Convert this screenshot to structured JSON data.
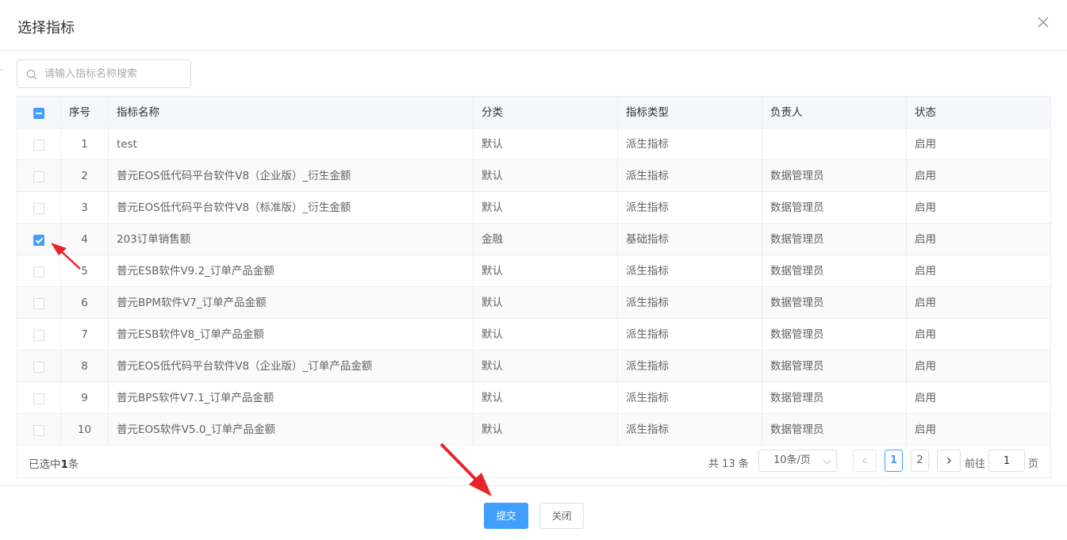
{
  "dialog": {
    "title": "选择指标"
  },
  "search": {
    "placeholder": "请输入指标名称搜索",
    "value": ""
  },
  "table": {
    "columns": [
      "序号",
      "指标名称",
      "分类",
      "指标类型",
      "负责人",
      "状态"
    ],
    "rows": [
      {
        "index": "1",
        "name": "test",
        "category": "默认",
        "type": "派生指标",
        "owner": "",
        "status": "启用",
        "checked": false
      },
      {
        "index": "2",
        "name": "普元EOS低代码平台软件V8（企业版）_衍生金额",
        "category": "默认",
        "type": "派生指标",
        "owner": "数据管理员",
        "status": "启用",
        "checked": false
      },
      {
        "index": "3",
        "name": "普元EOS低代码平台软件V8（标准版）_衍生金额",
        "category": "默认",
        "type": "派生指标",
        "owner": "数据管理员",
        "status": "启用",
        "checked": false
      },
      {
        "index": "4",
        "name": "203订单销售额",
        "category": "金融",
        "type": "基础指标",
        "owner": "数据管理员",
        "status": "启用",
        "checked": true
      },
      {
        "index": "5",
        "name": "普元ESB软件V9.2_订单产品金额",
        "category": "默认",
        "type": "派生指标",
        "owner": "数据管理员",
        "status": "启用",
        "checked": false
      },
      {
        "index": "6",
        "name": "普元BPM软件V7_订单产品金额",
        "category": "默认",
        "type": "派生指标",
        "owner": "数据管理员",
        "status": "启用",
        "checked": false
      },
      {
        "index": "7",
        "name": "普元ESB软件V8_订单产品金额",
        "category": "默认",
        "type": "派生指标",
        "owner": "数据管理员",
        "status": "启用",
        "checked": false
      },
      {
        "index": "8",
        "name": "普元EOS低代码平台软件V8（企业版）_订单产品金额",
        "category": "默认",
        "type": "派生指标",
        "owner": "数据管理员",
        "status": "启用",
        "checked": false
      },
      {
        "index": "9",
        "name": "普元BPS软件V7.1_订单产品金额",
        "category": "默认",
        "type": "派生指标",
        "owner": "数据管理员",
        "status": "启用",
        "checked": false
      },
      {
        "index": "10",
        "name": "普元EOS软件V5.0_订单产品金额",
        "category": "默认",
        "type": "派生指标",
        "owner": "数据管理员",
        "status": "启用",
        "checked": false
      }
    ]
  },
  "selection": {
    "prefix": "已选中",
    "count": "1",
    "suffix": "条"
  },
  "pagination": {
    "total_text": "共 13 条",
    "page_size": "10条/页",
    "pages": [
      "1",
      "2"
    ],
    "current_page": "1",
    "goto_label": "前往",
    "goto_value": "1",
    "goto_suffix": "页"
  },
  "footer": {
    "submit_label": "提交",
    "close_label": "关闭"
  },
  "colors": {
    "primary": "#409eff",
    "annotation_arrow": "#e8242b"
  }
}
